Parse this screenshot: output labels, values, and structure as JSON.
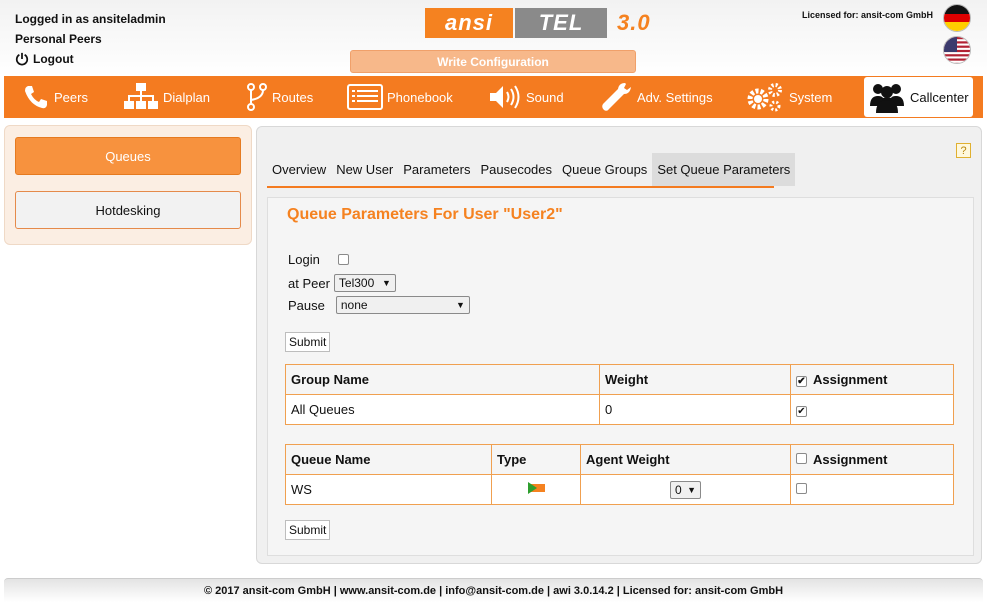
{
  "header": {
    "logged_in": "Logged in as ansiteladmin",
    "personal_peers": "Personal Peers",
    "logout": "Logout",
    "logo_ansi": "ansi",
    "logo_tel": "TEL",
    "logo_version": "3.0",
    "write_configuration": "Write Configuration",
    "licensed": "Licensed for: ansit-com GmbH"
  },
  "nav": {
    "items": [
      {
        "label": "Peers",
        "icon": "phone-icon"
      },
      {
        "label": "Dialplan",
        "icon": "sitemap-icon"
      },
      {
        "label": "Routes",
        "icon": "routes-icon"
      },
      {
        "label": "Phonebook",
        "icon": "phonebook-icon"
      },
      {
        "label": "Sound",
        "icon": "speaker-icon"
      },
      {
        "label": "Adv. Settings",
        "icon": "wrench-icon"
      },
      {
        "label": "System",
        "icon": "gears-icon"
      },
      {
        "label": "Callcenter",
        "icon": "users-icon"
      }
    ],
    "active": "Callcenter"
  },
  "sidebar": {
    "items": [
      {
        "label": "Queues"
      },
      {
        "label": "Hotdesking"
      }
    ]
  },
  "tabs": [
    {
      "label": "Overview"
    },
    {
      "label": "New User"
    },
    {
      "label": "Parameters"
    },
    {
      "label": "Pausecodes"
    },
    {
      "label": "Queue Groups"
    },
    {
      "label": "Set Queue Parameters"
    }
  ],
  "panel": {
    "title": "Queue Parameters For User \"User2\"",
    "login_label": "Login",
    "peer_label": "at Peer",
    "peer_value": "Tel300",
    "pause_label": "Pause",
    "pause_value": "none",
    "submit": "Submit"
  },
  "group_table": {
    "headers": [
      "Group Name",
      "Weight",
      "Assignment"
    ],
    "rows": [
      {
        "name": "All Queues",
        "weight": "0",
        "assigned": true
      }
    ]
  },
  "queue_table": {
    "headers": [
      "Queue Name",
      "Type",
      "Agent Weight",
      "Assignment"
    ],
    "rows": [
      {
        "name": "WS",
        "agent_weight": "0",
        "assigned": false
      }
    ]
  },
  "footer": {
    "text": "© 2017 ansit-com GmbH | www.ansit-com.de | info@ansit-com.de | awi 3.0.14.2 | Licensed for: ansit-com GmbH"
  },
  "colors": {
    "accent": "#f47b20",
    "title": "#f58220"
  }
}
